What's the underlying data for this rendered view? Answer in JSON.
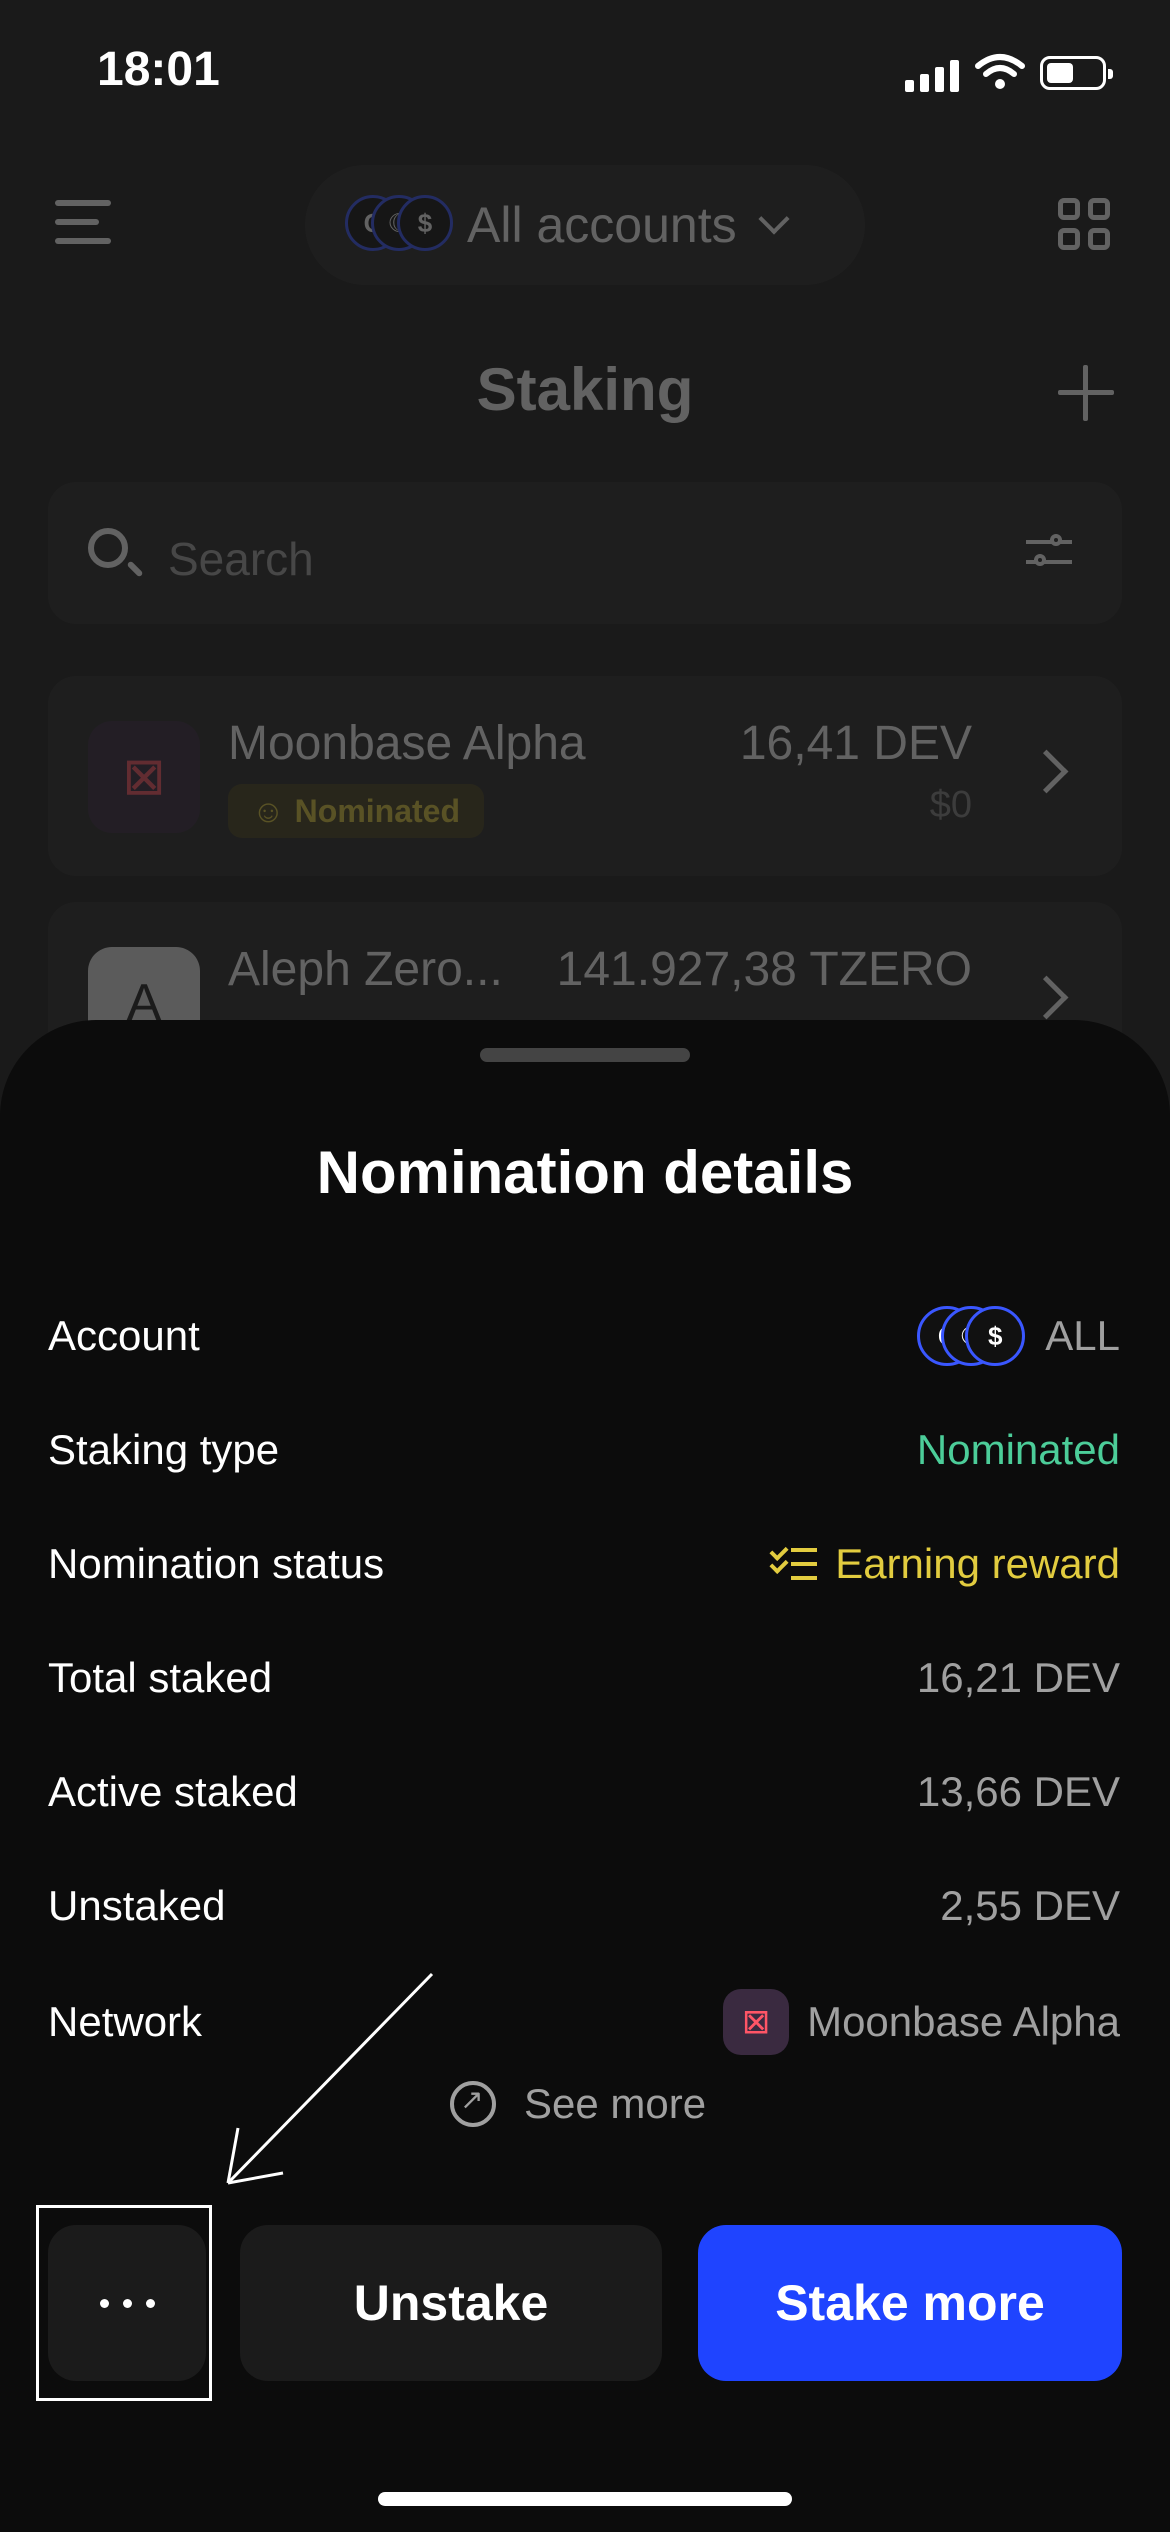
{
  "status_bar": {
    "time": "18:01"
  },
  "header": {
    "account_selector_label": "All accounts",
    "avatar_glyphs": [
      "C",
      "☾",
      "$"
    ]
  },
  "staking": {
    "title": "Staking",
    "search": {
      "placeholder": "Search"
    },
    "items": [
      {
        "name": "Moonbase Alpha",
        "badge": "Nominated",
        "amount": "16,41 DEV",
        "fiat": "$0"
      },
      {
        "name": "Aleph Zero...",
        "amount": "141.927,38 TZERO"
      }
    ]
  },
  "sheet": {
    "title": "Nomination details",
    "rows": [
      {
        "label": "Account",
        "value": "ALL"
      },
      {
        "label": "Staking type",
        "value": "Nominated"
      },
      {
        "label": "Nomination status",
        "value": "Earning reward"
      },
      {
        "label": "Total staked",
        "value": "16,21 DEV"
      },
      {
        "label": "Active staked",
        "value": "13,66 DEV"
      },
      {
        "label": "Unstaked",
        "value": "2,55 DEV"
      },
      {
        "label": "Network",
        "value": "Moonbase Alpha"
      }
    ],
    "see_more": "See more",
    "buttons": {
      "unstake": "Unstake",
      "stake_more": "Stake more"
    }
  },
  "colors": {
    "accent_blue": "#1f44ff",
    "nominated_green": "#4ccd99",
    "earning_yellow": "#e2cc3f"
  },
  "icons": [
    "menu-icon",
    "qr-code-icon",
    "add-icon",
    "search-icon",
    "filter-icon",
    "chevron-right-icon",
    "list-check-icon",
    "external-link-icon",
    "more-dots-icon"
  ]
}
